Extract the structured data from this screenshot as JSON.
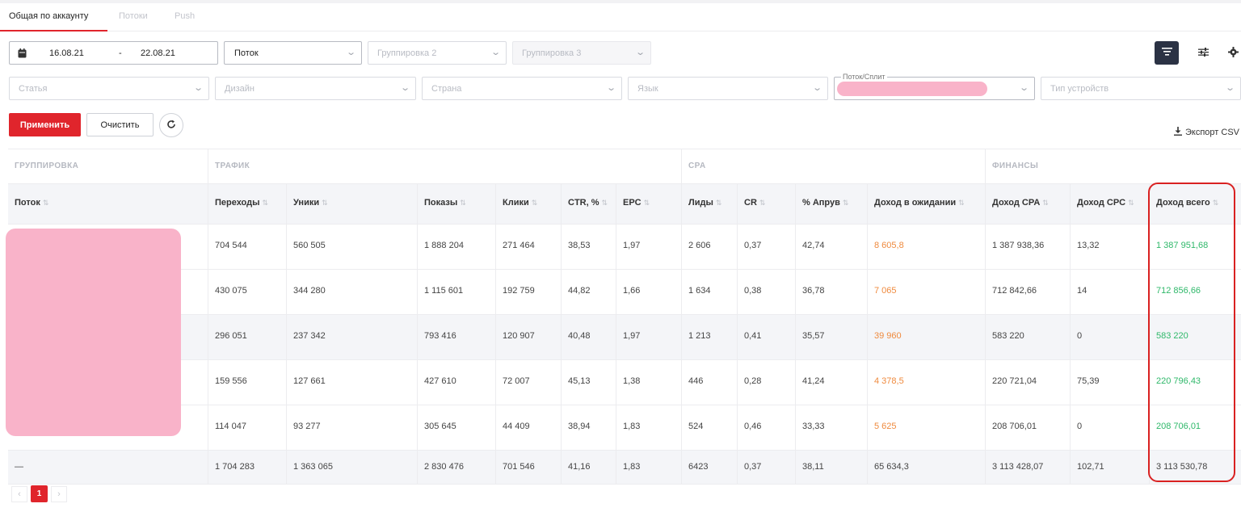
{
  "tabs": [
    {
      "label": "Общая по аккаунту"
    },
    {
      "label": "Потоки"
    },
    {
      "label": "Push"
    }
  ],
  "filters": {
    "date_from": "16.08.21",
    "date_sep": "-",
    "date_to": "22.08.21",
    "group1": "Поток",
    "group2_placeholder": "Группировка 2",
    "group3_placeholder": "Группировка 3",
    "article_placeholder": "Статья",
    "design_placeholder": "Дизайн",
    "country_placeholder": "Страна",
    "language_placeholder": "Язык",
    "stream_split_label": "Поток/Сплит",
    "device_placeholder": "Тип устройств"
  },
  "actions": {
    "apply": "Применить",
    "clear": "Очистить",
    "export": "Экспорт CSV"
  },
  "groups": {
    "grouping": "ГРУППИРОВКА",
    "traffic": "ТРАФИК",
    "cpa": "CPA",
    "finance": "ФИНАНСЫ"
  },
  "columns": [
    {
      "label": "Поток"
    },
    {
      "label": "Переходы"
    },
    {
      "label": "Уники"
    },
    {
      "label": "Показы"
    },
    {
      "label": "Клики"
    },
    {
      "label": "CTR, %"
    },
    {
      "label": "EPC"
    },
    {
      "label": "Лиды"
    },
    {
      "label": "CR"
    },
    {
      "label": "% Апрув"
    },
    {
      "label": "Доход в ожидании"
    },
    {
      "label": "Доход CPA"
    },
    {
      "label": "Доход CPC"
    },
    {
      "label": "Доход всего"
    }
  ],
  "rows": [
    [
      "",
      "704 544",
      "560 505",
      "1 888 204",
      "271 464",
      "38,53",
      "1,97",
      "2 606",
      "0,37",
      "42,74",
      "8 605,8",
      "1 387 938,36",
      "13,32",
      "1 387 951,68"
    ],
    [
      "",
      "430 075",
      "344 280",
      "1 115 601",
      "192 759",
      "44,82",
      "1,66",
      "1 634",
      "0,38",
      "36,78",
      "7 065",
      "712 842,66",
      "14",
      "712 856,66"
    ],
    [
      "",
      "296 051",
      "237 342",
      "793 416",
      "120 907",
      "40,48",
      "1,97",
      "1 213",
      "0,41",
      "35,57",
      "39 960",
      "583 220",
      "0",
      "583 220"
    ],
    [
      "",
      "159 556",
      "127 661",
      "427 610",
      "72 007",
      "45,13",
      "1,38",
      "446",
      "0,28",
      "41,24",
      "4 378,5",
      "220 721,04",
      "75,39",
      "220 796,43"
    ],
    [
      "",
      "114 047",
      "93 277",
      "305 645",
      "44 409",
      "38,94",
      "1,83",
      "524",
      "0,46",
      "33,33",
      "5 625",
      "208 706,01",
      "0",
      "208 706,01"
    ]
  ],
  "total": [
    "—",
    "1 704 283",
    "1 363 065",
    "2 830 476",
    "701 546",
    "41,16",
    "1,83",
    "6423",
    "0,37",
    "38,11",
    "65 634,3",
    "3 113 428,07",
    "102,71",
    "3 113 530,78"
  ],
  "pager": {
    "current": "1",
    "prev": "‹",
    "next": "›"
  },
  "colors": {
    "accent": "#e0252c",
    "pending": "#ef8a3e",
    "total_income": "#2fb86a",
    "redaction": "#f9b3c9",
    "highlight": "#d92121"
  },
  "icons": [
    "calendar-icon",
    "list-view-icon",
    "sliders-icon",
    "gear-icon",
    "refresh-icon",
    "download-icon",
    "sort-icon",
    "chevron-down-icon"
  ]
}
